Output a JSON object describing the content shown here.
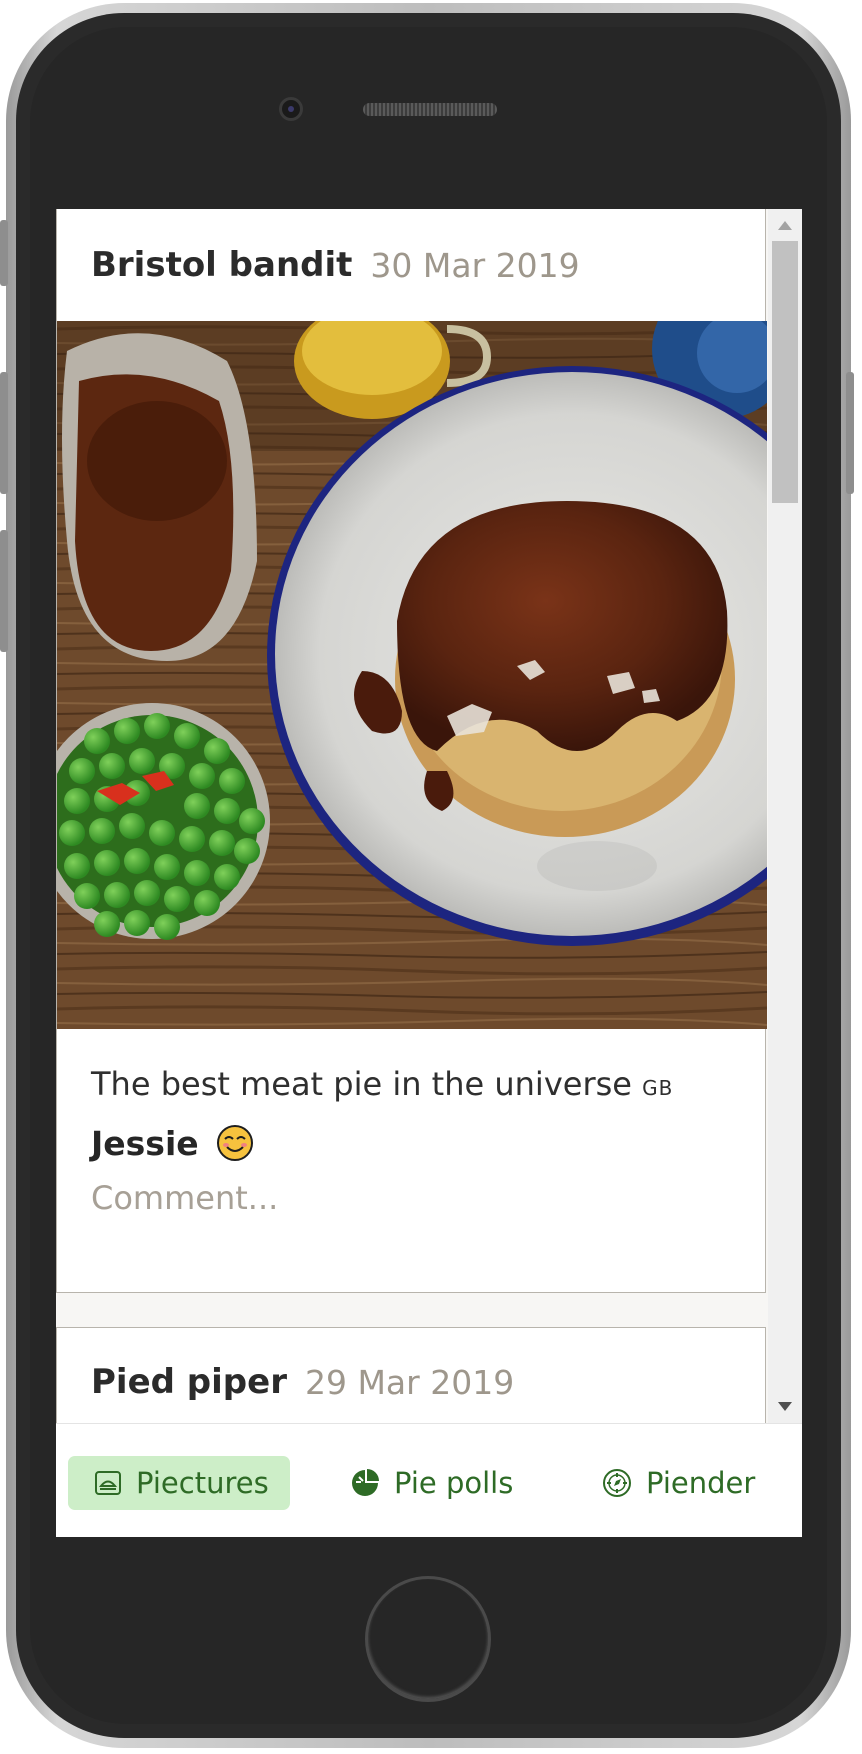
{
  "posts": [
    {
      "username": "Bristol bandit",
      "date": "30 Mar 2019",
      "caption": "The best meat pie in the universe",
      "flag": "GB",
      "commenter": "Jessie",
      "comment_placeholder": "Comment..."
    },
    {
      "username": "Pied piper",
      "date": "29 Mar 2019"
    }
  ],
  "tabs": [
    {
      "label": "Piectures",
      "icon": "pie-picture-icon",
      "active": true
    },
    {
      "label": "Pie polls",
      "icon": "pie-chart-icon",
      "active": false
    },
    {
      "label": "Piender",
      "icon": "compass-icon",
      "active": false
    }
  ],
  "colors": {
    "tab_text": "#2e6b26",
    "tab_active_bg": "#cdeec8",
    "date_text": "#9e978c"
  }
}
